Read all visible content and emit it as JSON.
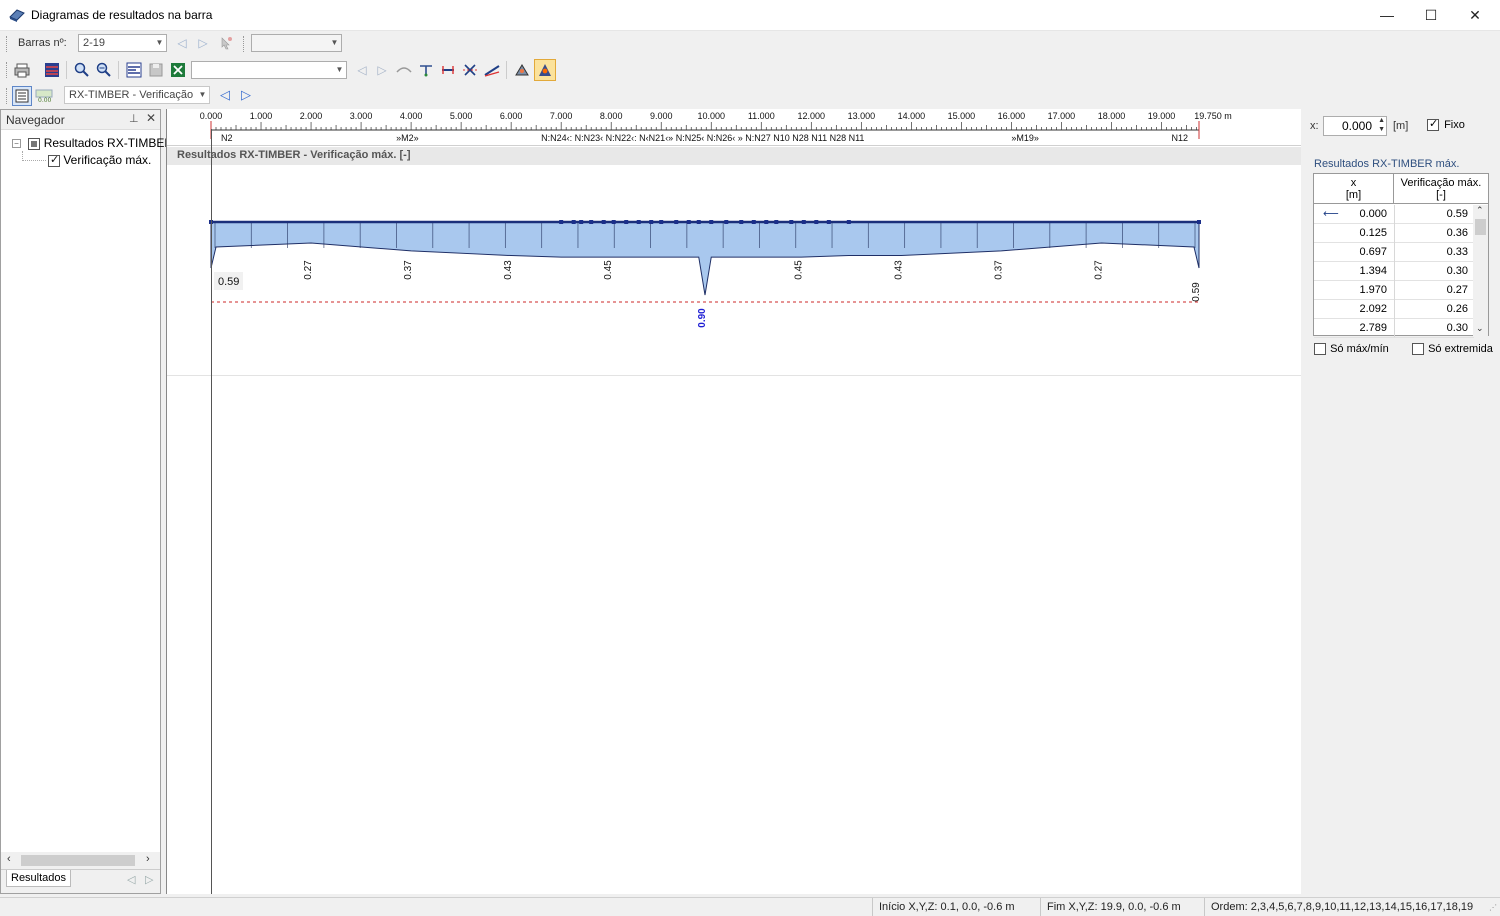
{
  "window": {
    "title": "Diagramas de resultados na barra",
    "minimize": "—",
    "maximize": "☐",
    "close": "✕"
  },
  "toolbar1": {
    "barras_label": "Barras nº:",
    "barras_value": "2-19",
    "combo2_value": ""
  },
  "toolbar2": {
    "combo_value": ""
  },
  "toolbar3": {
    "module_value": "RX-TIMBER -  Verificação"
  },
  "navigator": {
    "title": "Navegador",
    "root_label": "Resultados RX-TIMBER",
    "child_label": "Verificação máx.",
    "tab_label": "Resultados"
  },
  "ruler": {
    "ticks": [
      "0.000",
      "1.000",
      "2.000",
      "3.000",
      "4.000",
      "5.000",
      "6.000",
      "7.000",
      "8.000",
      "9.000",
      "10.000",
      "11.000",
      "12.000",
      "13.000",
      "14.000",
      "15.000",
      "16.000",
      "17.000",
      "18.000",
      "19.000",
      "19.750 m"
    ],
    "nodes": [
      {
        "t": "N2",
        "x": 0.2
      },
      {
        "t": "»M2»",
        "x": 3.7
      },
      {
        "t": "N:N24‹: N:N23‹ N:N22‹: N‹N21‹» N:N25‹ N:N26‹ » N:N27 N10 N28 N11 N28 N11",
        "x": 6.6
      },
      {
        "t": "»M19»",
        "x": 16.0
      },
      {
        "t": "N12",
        "x": 19.2
      }
    ]
  },
  "result_title": "Resultados RX-TIMBER - Verificação máx. [-]",
  "chart_data": {
    "type": "area",
    "title": "Resultados RX-TIMBER - Verificação máx. [-]",
    "xlabel": "x [m]",
    "ylabel": "Verificação máx. [-]",
    "x": [
      0.0,
      0.1,
      2.0,
      4.0,
      6.0,
      7.0,
      9.0,
      9.75,
      9.875,
      10.0,
      10.75,
      11.8,
      12.75,
      13.8,
      15.8,
      17.8,
      19.65,
      19.75
    ],
    "y": [
      0.59,
      0.32,
      0.27,
      0.37,
      0.43,
      0.45,
      0.45,
      0.45,
      0.9,
      0.45,
      0.45,
      0.45,
      0.43,
      0.43,
      0.37,
      0.27,
      0.32,
      0.59
    ],
    "labels": [
      {
        "x": 2.0,
        "text": "0.27"
      },
      {
        "x": 4.0,
        "text": "0.37"
      },
      {
        "x": 6.0,
        "text": "0.43"
      },
      {
        "x": 8.0,
        "text": "0.45"
      },
      {
        "x": 9.875,
        "text": "0.90"
      },
      {
        "x": 11.8,
        "text": "0.45"
      },
      {
        "x": 13.8,
        "text": "0.43"
      },
      {
        "x": 15.8,
        "text": "0.37"
      },
      {
        "x": 17.8,
        "text": "0.27"
      },
      {
        "x": 19.75,
        "text": "0.59"
      }
    ],
    "marker_label": "0.59",
    "max_value": 0.9,
    "xlim": [
      0,
      19.75
    ],
    "colors": {
      "fill": "#a9c8ee",
      "line": "#1b2f7a",
      "max": "#1f1fd4",
      "limit": "#cc2a2a"
    }
  },
  "right_panel": {
    "x_label": "x:",
    "x_value": "0.000",
    "x_unit": "[m]",
    "fixo_label": "Fixo",
    "table_title": "Resultados RX-TIMBER  máx.",
    "col1_header": "x",
    "col1_unit": "[m]",
    "col2_header": "Verificação máx.",
    "col2_unit": "[-]",
    "rows": [
      {
        "x": "0.000",
        "v": "0.59"
      },
      {
        "x": "0.125",
        "v": "0.36"
      },
      {
        "x": "0.697",
        "v": "0.33"
      },
      {
        "x": "1.394",
        "v": "0.30"
      },
      {
        "x": "1.970",
        "v": "0.27"
      },
      {
        "x": "2.092",
        "v": "0.26"
      },
      {
        "x": "2.789",
        "v": "0.30"
      }
    ],
    "only_maxmin": "Só máx/mín",
    "only_extremes": "Só extremida"
  },
  "status": {
    "inicio": "Início X,Y,Z:   0.1, 0.0, -0.6 m",
    "fim": "Fim X,Y,Z:   19.9, 0.0, -0.6 m",
    "ordem": "Ordem:   2,3,4,5,6,7,8,9,10,11,12,13,14,15,16,17,18,19"
  }
}
